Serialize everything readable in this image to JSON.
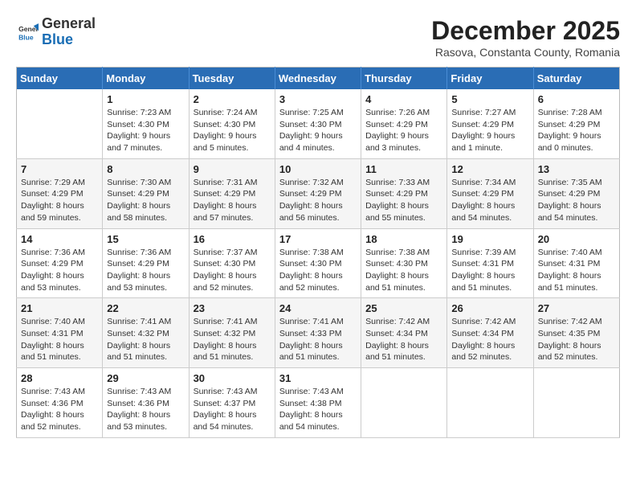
{
  "logo": {
    "line1": "General",
    "line2": "Blue"
  },
  "header": {
    "month": "December 2025",
    "location": "Rasova, Constanta County, Romania"
  },
  "weekdays": [
    "Sunday",
    "Monday",
    "Tuesday",
    "Wednesday",
    "Thursday",
    "Friday",
    "Saturday"
  ],
  "weeks": [
    [
      {
        "day": "",
        "info": ""
      },
      {
        "day": "1",
        "info": "Sunrise: 7:23 AM\nSunset: 4:30 PM\nDaylight: 9 hours\nand 7 minutes."
      },
      {
        "day": "2",
        "info": "Sunrise: 7:24 AM\nSunset: 4:30 PM\nDaylight: 9 hours\nand 5 minutes."
      },
      {
        "day": "3",
        "info": "Sunrise: 7:25 AM\nSunset: 4:30 PM\nDaylight: 9 hours\nand 4 minutes."
      },
      {
        "day": "4",
        "info": "Sunrise: 7:26 AM\nSunset: 4:29 PM\nDaylight: 9 hours\nand 3 minutes."
      },
      {
        "day": "5",
        "info": "Sunrise: 7:27 AM\nSunset: 4:29 PM\nDaylight: 9 hours\nand 1 minute."
      },
      {
        "day": "6",
        "info": "Sunrise: 7:28 AM\nSunset: 4:29 PM\nDaylight: 9 hours\nand 0 minutes."
      }
    ],
    [
      {
        "day": "7",
        "info": "Sunrise: 7:29 AM\nSunset: 4:29 PM\nDaylight: 8 hours\nand 59 minutes."
      },
      {
        "day": "8",
        "info": "Sunrise: 7:30 AM\nSunset: 4:29 PM\nDaylight: 8 hours\nand 58 minutes."
      },
      {
        "day": "9",
        "info": "Sunrise: 7:31 AM\nSunset: 4:29 PM\nDaylight: 8 hours\nand 57 minutes."
      },
      {
        "day": "10",
        "info": "Sunrise: 7:32 AM\nSunset: 4:29 PM\nDaylight: 8 hours\nand 56 minutes."
      },
      {
        "day": "11",
        "info": "Sunrise: 7:33 AM\nSunset: 4:29 PM\nDaylight: 8 hours\nand 55 minutes."
      },
      {
        "day": "12",
        "info": "Sunrise: 7:34 AM\nSunset: 4:29 PM\nDaylight: 8 hours\nand 54 minutes."
      },
      {
        "day": "13",
        "info": "Sunrise: 7:35 AM\nSunset: 4:29 PM\nDaylight: 8 hours\nand 54 minutes."
      }
    ],
    [
      {
        "day": "14",
        "info": "Sunrise: 7:36 AM\nSunset: 4:29 PM\nDaylight: 8 hours\nand 53 minutes."
      },
      {
        "day": "15",
        "info": "Sunrise: 7:36 AM\nSunset: 4:29 PM\nDaylight: 8 hours\nand 53 minutes."
      },
      {
        "day": "16",
        "info": "Sunrise: 7:37 AM\nSunset: 4:30 PM\nDaylight: 8 hours\nand 52 minutes."
      },
      {
        "day": "17",
        "info": "Sunrise: 7:38 AM\nSunset: 4:30 PM\nDaylight: 8 hours\nand 52 minutes."
      },
      {
        "day": "18",
        "info": "Sunrise: 7:38 AM\nSunset: 4:30 PM\nDaylight: 8 hours\nand 51 minutes."
      },
      {
        "day": "19",
        "info": "Sunrise: 7:39 AM\nSunset: 4:31 PM\nDaylight: 8 hours\nand 51 minutes."
      },
      {
        "day": "20",
        "info": "Sunrise: 7:40 AM\nSunset: 4:31 PM\nDaylight: 8 hours\nand 51 minutes."
      }
    ],
    [
      {
        "day": "21",
        "info": "Sunrise: 7:40 AM\nSunset: 4:31 PM\nDaylight: 8 hours\nand 51 minutes."
      },
      {
        "day": "22",
        "info": "Sunrise: 7:41 AM\nSunset: 4:32 PM\nDaylight: 8 hours\nand 51 minutes."
      },
      {
        "day": "23",
        "info": "Sunrise: 7:41 AM\nSunset: 4:32 PM\nDaylight: 8 hours\nand 51 minutes."
      },
      {
        "day": "24",
        "info": "Sunrise: 7:41 AM\nSunset: 4:33 PM\nDaylight: 8 hours\nand 51 minutes."
      },
      {
        "day": "25",
        "info": "Sunrise: 7:42 AM\nSunset: 4:34 PM\nDaylight: 8 hours\nand 51 minutes."
      },
      {
        "day": "26",
        "info": "Sunrise: 7:42 AM\nSunset: 4:34 PM\nDaylight: 8 hours\nand 52 minutes."
      },
      {
        "day": "27",
        "info": "Sunrise: 7:42 AM\nSunset: 4:35 PM\nDaylight: 8 hours\nand 52 minutes."
      }
    ],
    [
      {
        "day": "28",
        "info": "Sunrise: 7:43 AM\nSunset: 4:36 PM\nDaylight: 8 hours\nand 52 minutes."
      },
      {
        "day": "29",
        "info": "Sunrise: 7:43 AM\nSunset: 4:36 PM\nDaylight: 8 hours\nand 53 minutes."
      },
      {
        "day": "30",
        "info": "Sunrise: 7:43 AM\nSunset: 4:37 PM\nDaylight: 8 hours\nand 54 minutes."
      },
      {
        "day": "31",
        "info": "Sunrise: 7:43 AM\nSunset: 4:38 PM\nDaylight: 8 hours\nand 54 minutes."
      },
      {
        "day": "",
        "info": ""
      },
      {
        "day": "",
        "info": ""
      },
      {
        "day": "",
        "info": ""
      }
    ]
  ]
}
